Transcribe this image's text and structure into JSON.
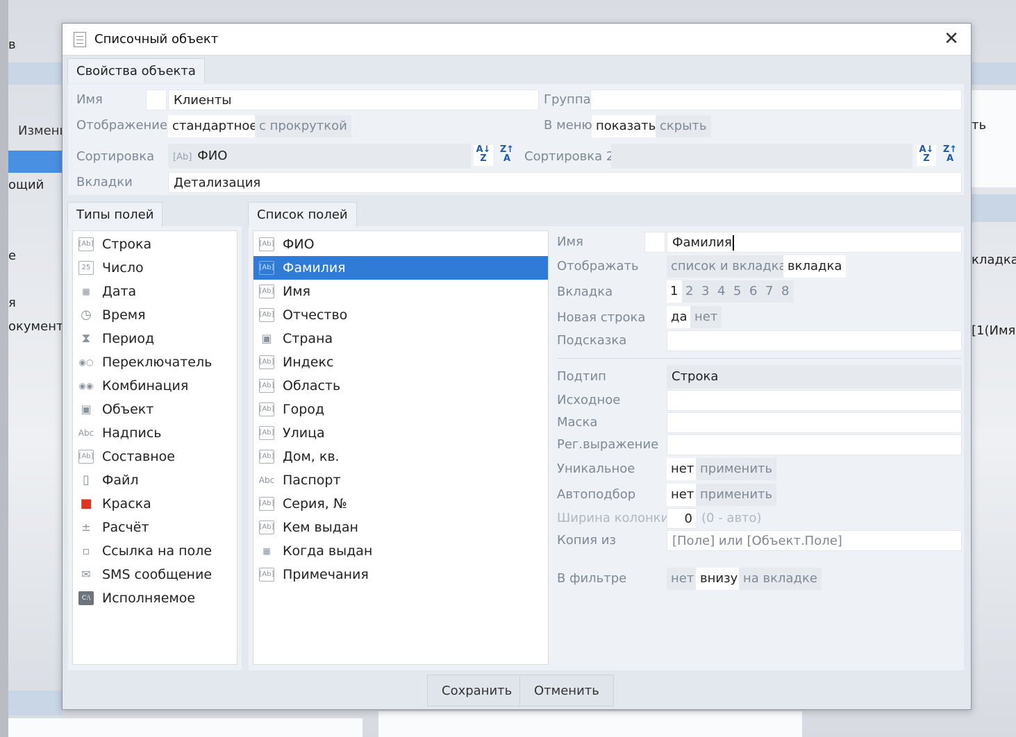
{
  "background": {
    "left_items": [
      "в",
      "Измени",
      "ощий",
      "е",
      "я",
      "окументо"
    ],
    "right_items": [
      "ть",
      "кладка",
      "[1(Имя"
    ]
  },
  "dialog": {
    "title": "Списочный объект",
    "close_label": "✕",
    "props_tab": "Свойства объекта",
    "name": {
      "label": "Имя",
      "value": "Клиенты"
    },
    "group": {
      "label": "Группа",
      "value": ""
    },
    "display": {
      "label": "Отображение",
      "options": [
        "стандартное",
        "с прокруткой"
      ],
      "selected": "стандартное"
    },
    "in_menu": {
      "label": "В меню",
      "options": [
        "показать",
        "скрыть"
      ],
      "selected": "показать"
    },
    "sort": {
      "label": "Сортировка",
      "badge": "[Ab]",
      "value": "ФИО",
      "asc": "A↓ Z",
      "desc": "Z↑ A"
    },
    "sort2": {
      "label": "Сортировка 2",
      "value": ""
    },
    "tabs": {
      "label": "Вкладки",
      "value": "Детализация"
    },
    "types_tab": "Типы полей",
    "fields_tab": "Список полей",
    "field_types": [
      {
        "icon": "[Ab]",
        "label": "Строка"
      },
      {
        "icon": "25",
        "label": "Число"
      },
      {
        "icon": "▦",
        "label": "Дата"
      },
      {
        "icon": "◷",
        "label": "Время"
      },
      {
        "icon": "⧗",
        "label": "Период"
      },
      {
        "icon": "◉○",
        "label": "Переключатель"
      },
      {
        "icon": "◉◉",
        "label": "Комбинация"
      },
      {
        "icon": "▣",
        "label": "Объект"
      },
      {
        "icon": "Abc",
        "label": "Надпись"
      },
      {
        "icon": "[Ab]",
        "label": "Составное"
      },
      {
        "icon": "▯",
        "label": "Файл"
      },
      {
        "icon": "■",
        "label": "Краска"
      },
      {
        "icon": "±",
        "label": "Расчёт"
      },
      {
        "icon": "▫",
        "label": "Ссылка на поле"
      },
      {
        "icon": "✉",
        "label": "SMS сообщение"
      },
      {
        "icon": "C:\\",
        "label": "Исполняемое"
      }
    ],
    "fields": [
      {
        "icon": "[Ab]",
        "label": "ФИО"
      },
      {
        "icon": "[Ab]",
        "label": "Фамилия"
      },
      {
        "icon": "[Ab]",
        "label": "Имя"
      },
      {
        "icon": "[Ab]",
        "label": "Отчество"
      },
      {
        "icon": "▣",
        "label": "Страна"
      },
      {
        "icon": "[Ab]",
        "label": "Индекс"
      },
      {
        "icon": "[Ab]",
        "label": "Область"
      },
      {
        "icon": "[Ab]",
        "label": "Город"
      },
      {
        "icon": "[Ab]",
        "label": "Улица"
      },
      {
        "icon": "[Ab]",
        "label": "Дом, кв."
      },
      {
        "icon": "Abc",
        "label": "Паспорт"
      },
      {
        "icon": "[Ab]",
        "label": "Серия, №"
      },
      {
        "icon": "[Ab]",
        "label": "Кем выдан"
      },
      {
        "icon": "▦",
        "label": "Когда выдан"
      },
      {
        "icon": "[Ab]",
        "label": "Примечания"
      }
    ],
    "selected_field_index": 1,
    "detail": {
      "name": {
        "label": "Имя",
        "value": "Фамилия"
      },
      "show": {
        "label": "Отображать",
        "options": [
          "список и вкладка",
          "вкладка"
        ],
        "selected": "вкладка"
      },
      "tab": {
        "label": "Вкладка",
        "options": [
          "1",
          "2",
          "3",
          "4",
          "5",
          "6",
          "7",
          "8"
        ],
        "selected": "1"
      },
      "new_line": {
        "label": "Новая строка",
        "options": [
          "да",
          "нет"
        ],
        "selected": "да"
      },
      "hint": {
        "label": "Подсказка",
        "value": ""
      },
      "subtype": {
        "label": "Подтип",
        "value": "Строка"
      },
      "source": {
        "label": "Исходное",
        "value": ""
      },
      "mask": {
        "label": "Маска",
        "value": ""
      },
      "regex": {
        "label": "Рег.выражение",
        "value": ""
      },
      "unique": {
        "label": "Уникальное",
        "value": "нет",
        "apply": "применить"
      },
      "autopick": {
        "label": "Автоподбор",
        "value": "нет",
        "apply": "применить"
      },
      "col_width": {
        "label": "Ширина колонки",
        "value": "0",
        "hint": "(0 - авто)"
      },
      "copy_from": {
        "label": "Копия из",
        "placeholder": "[Поле] или [Объект.Поле]"
      },
      "in_filter": {
        "label": "В фильтре",
        "options": [
          "нет",
          "внизу",
          "на вкладке"
        ],
        "selected": "внизу"
      }
    },
    "save_label": "Сохранить",
    "cancel_label": "Отменить"
  }
}
